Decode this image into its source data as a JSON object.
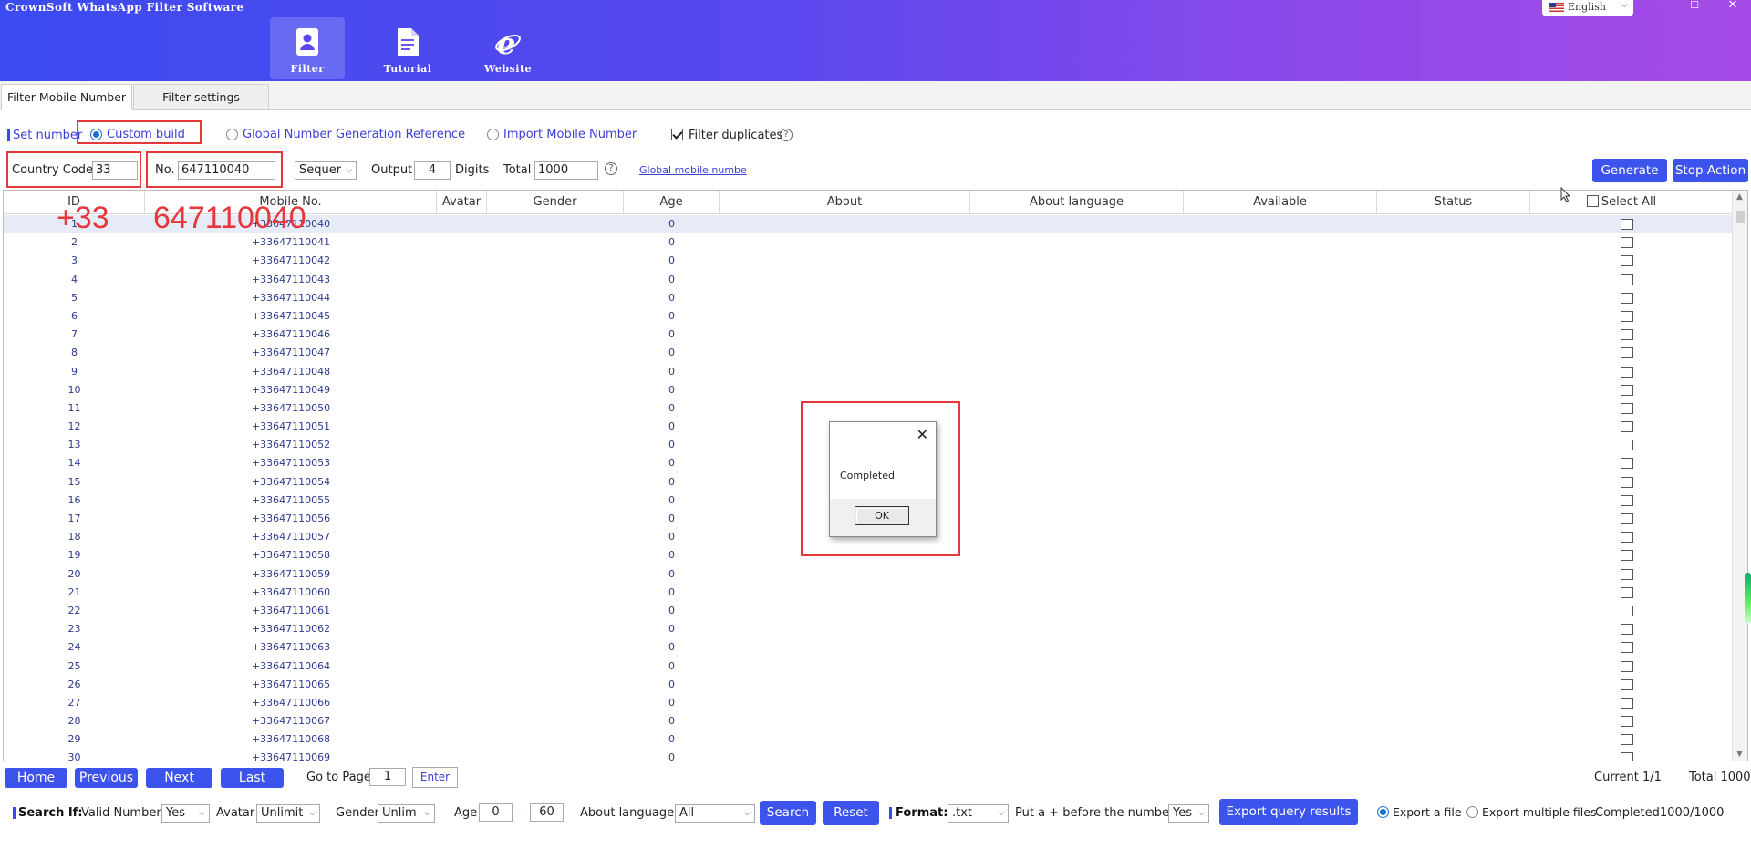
{
  "window": {
    "title": "CrownSoft WhatsApp Filter Software",
    "language": "English",
    "minimize": "—",
    "maximize": "☐",
    "close": "✕"
  },
  "nav": {
    "filter": "Filter",
    "tutorial": "Tutorial",
    "website": "Website"
  },
  "tabs": [
    "Filter Mobile Number",
    "Filter settings"
  ],
  "set_number": {
    "label": "Set number",
    "options": [
      "Custom build",
      "Global Number Generation Reference",
      "Import Mobile Number"
    ],
    "selected": "Custom build",
    "filter_duplicates": "Filter duplicates",
    "filter_duplicates_checked": true
  },
  "generator": {
    "country_code_label": "Country Code",
    "country_code": "33",
    "no_label": "No.",
    "no_value": "647110040",
    "mode": "Sequer",
    "output_label": "Output",
    "output_value": "4",
    "digits_label": "Digits",
    "total_label": "Total",
    "total_value": "1000",
    "help": "?",
    "global_link": "Global mobile numbe",
    "generate_btn": "Generate",
    "stop_btn": "Stop Action"
  },
  "annotations": {
    "code": "+33",
    "number": "647110040"
  },
  "table": {
    "columns": [
      "ID",
      "Mobile No.",
      "Avatar",
      "Gender",
      "Age",
      "About",
      "About language",
      "Available",
      "Status",
      "Select All"
    ],
    "rows": [
      {
        "id": "1",
        "mobile": "+33647110040",
        "age": "0"
      },
      {
        "id": "2",
        "mobile": "+33647110041",
        "age": "0"
      },
      {
        "id": "3",
        "mobile": "+33647110042",
        "age": "0"
      },
      {
        "id": "4",
        "mobile": "+33647110043",
        "age": "0"
      },
      {
        "id": "5",
        "mobile": "+33647110044",
        "age": "0"
      },
      {
        "id": "6",
        "mobile": "+33647110045",
        "age": "0"
      },
      {
        "id": "7",
        "mobile": "+33647110046",
        "age": "0"
      },
      {
        "id": "8",
        "mobile": "+33647110047",
        "age": "0"
      },
      {
        "id": "9",
        "mobile": "+33647110048",
        "age": "0"
      },
      {
        "id": "10",
        "mobile": "+33647110049",
        "age": "0"
      },
      {
        "id": "11",
        "mobile": "+33647110050",
        "age": "0"
      },
      {
        "id": "12",
        "mobile": "+33647110051",
        "age": "0"
      },
      {
        "id": "13",
        "mobile": "+33647110052",
        "age": "0"
      },
      {
        "id": "14",
        "mobile": "+33647110053",
        "age": "0"
      },
      {
        "id": "15",
        "mobile": "+33647110054",
        "age": "0"
      },
      {
        "id": "16",
        "mobile": "+33647110055",
        "age": "0"
      },
      {
        "id": "17",
        "mobile": "+33647110056",
        "age": "0"
      },
      {
        "id": "18",
        "mobile": "+33647110057",
        "age": "0"
      },
      {
        "id": "19",
        "mobile": "+33647110058",
        "age": "0"
      },
      {
        "id": "20",
        "mobile": "+33647110059",
        "age": "0"
      },
      {
        "id": "21",
        "mobile": "+33647110060",
        "age": "0"
      },
      {
        "id": "22",
        "mobile": "+33647110061",
        "age": "0"
      },
      {
        "id": "23",
        "mobile": "+33647110062",
        "age": "0"
      },
      {
        "id": "24",
        "mobile": "+33647110063",
        "age": "0"
      },
      {
        "id": "25",
        "mobile": "+33647110064",
        "age": "0"
      },
      {
        "id": "26",
        "mobile": "+33647110065",
        "age": "0"
      },
      {
        "id": "27",
        "mobile": "+33647110066",
        "age": "0"
      },
      {
        "id": "28",
        "mobile": "+33647110067",
        "age": "0"
      },
      {
        "id": "29",
        "mobile": "+33647110068",
        "age": "0"
      },
      {
        "id": "30",
        "mobile": "+33647110069",
        "age": "0"
      }
    ]
  },
  "dialog": {
    "message": "Completed",
    "ok": "OK",
    "close": "✕"
  },
  "pagination": {
    "home": "Home",
    "previous": "Previous",
    "next": "Next",
    "last": "Last",
    "goto_label": "Go to Page",
    "goto_value": "1",
    "enter": "Enter",
    "current": "Current 1/1",
    "total": "Total 1000"
  },
  "search": {
    "label": "Search If:",
    "valid_label": "Valid Number",
    "valid_value": "Yes",
    "avatar_label": "Avatar",
    "avatar_value": "Unlimit",
    "gender_label": "Gender",
    "gender_value": "Unlim",
    "age_label": "Age",
    "age_min": "0",
    "age_sep": "-",
    "age_max": "60",
    "about_lang_label": "About language",
    "about_lang_value": "All",
    "search_btn": "Search",
    "reset_btn": "Reset"
  },
  "export": {
    "format_label": "Format:",
    "format_value": ".txt",
    "plus_label": "Put a + before the number",
    "plus_value": "Yes",
    "export_btn": "Export query results",
    "opt_file": "Export a file",
    "opt_multi": "Export multiple files",
    "status": "Completed1000/1000"
  },
  "colors": {
    "accent": "#3d54ec",
    "annotation": "#e5383d"
  }
}
